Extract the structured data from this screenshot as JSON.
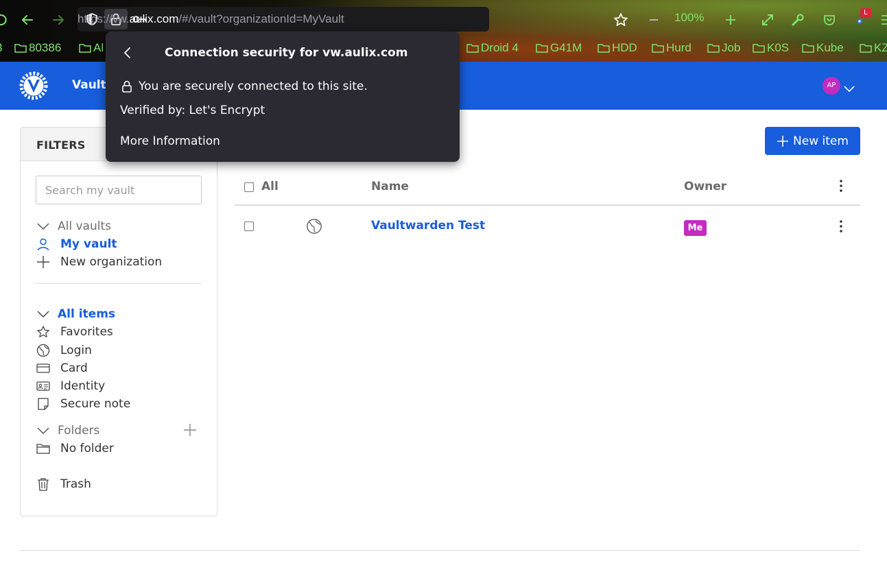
{
  "browser": {
    "url_prefix": "https://vw.",
    "url_host": "aulix.com",
    "url_path": "/#/vault?organizationId=MyVault",
    "zoom": "100%",
    "extension_badge": "L",
    "bookmarks": [
      "80386",
      "Al",
      "Droid 4",
      "G41M",
      "HDD",
      "Hurd",
      "Job",
      "K0S",
      "Kube",
      "KZ"
    ]
  },
  "security_popup": {
    "title": "Connection security for vw.aulix.com",
    "secure_text": "You are securely connected to this site.",
    "verified_text": "Verified by: Let's Encrypt",
    "more_info": "More Information"
  },
  "header": {
    "nav_vaults": "Vaults",
    "avatar_initials": "AP"
  },
  "sidebar": {
    "title": "FILTERS",
    "search_placeholder": "Search my vault",
    "vaults": {
      "all_vaults": "All vaults",
      "my_vault": "My vault",
      "new_org": "New organization"
    },
    "types": {
      "all_items": "All items",
      "favorites": "Favorites",
      "login": "Login",
      "card": "Card",
      "identity": "Identity",
      "secure_note": "Secure note"
    },
    "folders": {
      "label": "Folders",
      "no_folder": "No folder"
    },
    "trash": "Trash"
  },
  "main": {
    "new_item": "New item",
    "columns": {
      "all": "All",
      "name": "Name",
      "owner": "Owner"
    },
    "rows": [
      {
        "name": "Vaultwarden Test",
        "owner": "Me"
      }
    ]
  },
  "colors": {
    "brand": "#175ddc",
    "owner_badge": "#c42bbf",
    "browser_accent": "#7fe46b"
  }
}
